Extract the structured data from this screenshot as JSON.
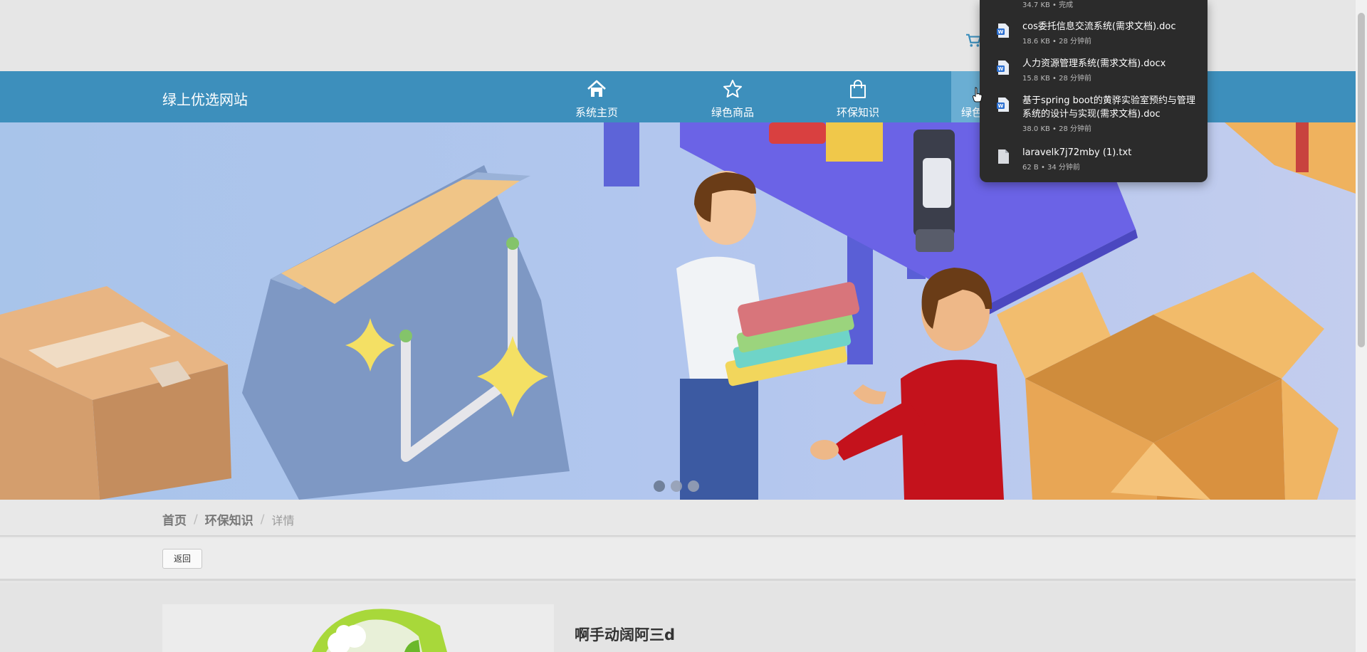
{
  "header": {
    "site_title": "绿上优选网站"
  },
  "nav": {
    "items": [
      {
        "label": "系统主页",
        "icon": "home-icon"
      },
      {
        "label": "绿色商品",
        "icon": "star-icon"
      },
      {
        "label": "环保知识",
        "icon": "shopping-bag-icon"
      },
      {
        "label": "绿色",
        "icon": "user-icon"
      }
    ]
  },
  "banner": {
    "slide_count": 3,
    "active_slide": 1
  },
  "breadcrumb": {
    "home": "首页",
    "section": "环保知识",
    "current": "详情",
    "separator": "/"
  },
  "toolbar": {
    "back_label": "返回"
  },
  "detail": {
    "title": "啊手动阔阿三d"
  },
  "downloads": {
    "top_partial_meta": "34.7 KB • 完成",
    "items": [
      {
        "name": "cos委托信息交流系统(需求文档).doc",
        "meta": "18.6 KB • 28 分钟前",
        "icon": "word-doc-icon"
      },
      {
        "name": "人力资源管理系统(需求文档).docx",
        "meta": "15.8 KB • 28 分钟前",
        "icon": "word-doc-icon"
      },
      {
        "name": "基于spring boot的黄骅实验室预约与管理系统的设计与实现(需求文档).doc",
        "meta": "38.0 KB • 28 分钟前",
        "icon": "word-doc-icon"
      },
      {
        "name": "laravelk7j72mby (1).txt",
        "meta": "62 B • 34 分钟前",
        "icon": "text-file-icon"
      }
    ]
  },
  "colors": {
    "nav_bg": "#3d8fbc",
    "nav_active": "#6aaed3",
    "popup_bg": "#2b2b2b"
  }
}
